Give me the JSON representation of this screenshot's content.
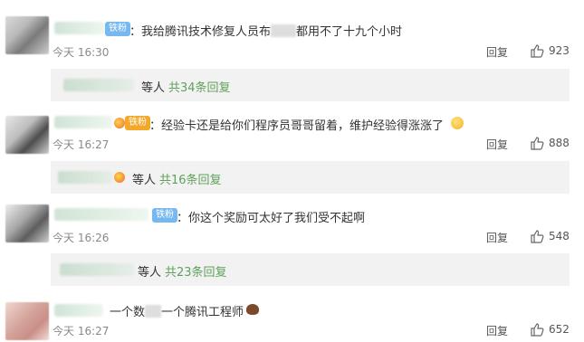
{
  "comments": [
    {
      "badge": "铁粉",
      "badge_color": "#76b8ef",
      "text_prefix": "：我给腾讯技术修复人员布",
      "text_suffix": "都用不了十九个小时",
      "time": "今天 16:30",
      "reply_label": "回复",
      "likes": "923",
      "sub": {
        "suffix": "等人",
        "total": "共34条回复"
      }
    },
    {
      "badge": "铁粉",
      "badge_color": "#f4a82a",
      "text_prefix": "：经验卡还是给你们程序员哥哥留着，维护经验得涨涨了",
      "text_suffix": "",
      "time": "今天 16:27",
      "reply_label": "回复",
      "likes": "888",
      "sub": {
        "suffix": "等人",
        "total": "共16条回复"
      }
    },
    {
      "badge": "铁粉",
      "badge_color": "#76b8ef",
      "text_prefix": "：你这个奖励可太好了我们受不起啊",
      "text_suffix": "",
      "time": "今天 16:26",
      "reply_label": "回复",
      "likes": "548",
      "sub": {
        "suffix": "等人",
        "total": "共23条回复"
      }
    },
    {
      "badge": "",
      "badge_color": "",
      "text_prefix": "一个数",
      "text_suffix": "一个腾讯工程师",
      "time": "今天 16:27",
      "reply_label": "回复",
      "likes": "652",
      "sub": null
    }
  ],
  "icons": {
    "like": "thumbs-up-icon",
    "fan_badge": "fan-badge-icon",
    "emoji": "emoji-icon",
    "poop": "poop-emoji-icon"
  }
}
